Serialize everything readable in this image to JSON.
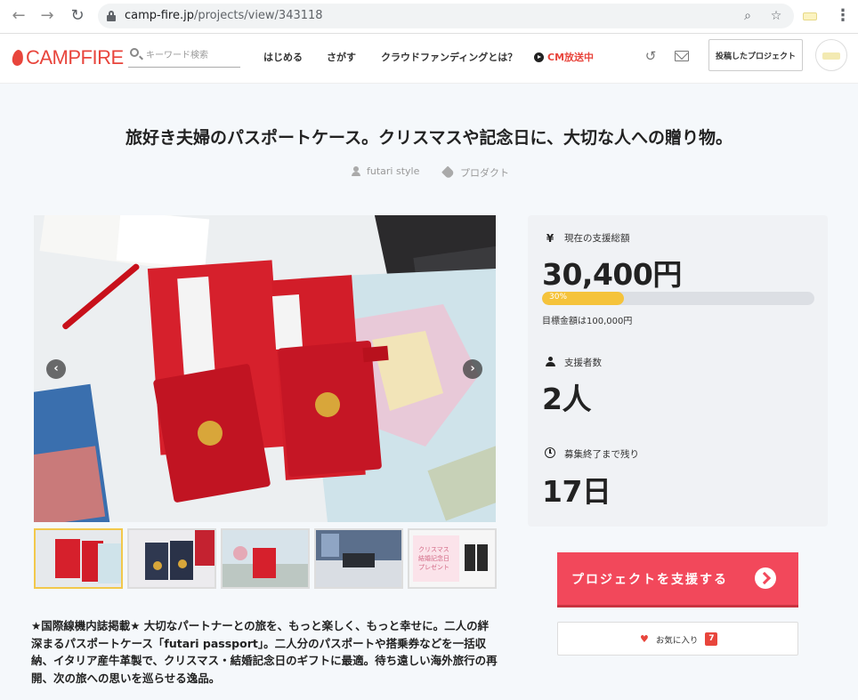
{
  "browser": {
    "url_host": "camp-fire.jp",
    "url_path": "/projects/view/343118"
  },
  "header": {
    "logo_text": "CAMPFIRE",
    "search_placeholder": "キーワード検索",
    "nav": [
      "はじめる",
      "さがす",
      "クラウドファンディングとは？"
    ],
    "cm_label": "CM放送中",
    "my_projects_label": "投稿したプロジェクト"
  },
  "project": {
    "title": "旅好き夫婦のパスポートケース。クリスマスや記念日に、大切な人への贈り物。",
    "owner": "futari style",
    "category": "プロダクト",
    "description": "★国際線機内誌掲載★ 大切なパートナーとの旅を、もっと楽しく、もっと幸せに。二人の絆深まるパスポートケース「futari passport」。二人分のパスポートや搭乗券などを一括収納、イタリア産牛革製で、クリスマス・結婚記念日のギフトに最適。待ち遠しい海外旅行の再開、次の旅への思いを巡らせる逸品。"
  },
  "gallery": {
    "active_index": 0,
    "thumbnail_text": [
      "クリスマス",
      "結婚記念日",
      "プレゼント"
    ]
  },
  "stats": {
    "total_label": "現在の支援総額",
    "total_value": "30,400円",
    "yen_icon": "¥",
    "progress_percent": 30,
    "progress_label": "30%",
    "goal_text": "目標金額は100,000円",
    "backers_label": "支援者数",
    "backers_value": "2人",
    "remaining_label": "募集終了まで残り",
    "remaining_value": "17日"
  },
  "actions": {
    "support_label": "プロジェクトを支援する",
    "favorite_label": "お気に入り",
    "favorite_count": "7"
  },
  "colors": {
    "brand": "#e8453c",
    "support_button": "#f2485b",
    "progress": "#f5c33b",
    "passport_red": "#d6202c"
  },
  "icons": {
    "back": "arrow-left-icon",
    "forward": "arrow-right-icon",
    "reload": "reload-icon",
    "zoom": "zoom-icon",
    "star": "star-icon",
    "history": "history-icon",
    "mail": "mail-icon"
  }
}
